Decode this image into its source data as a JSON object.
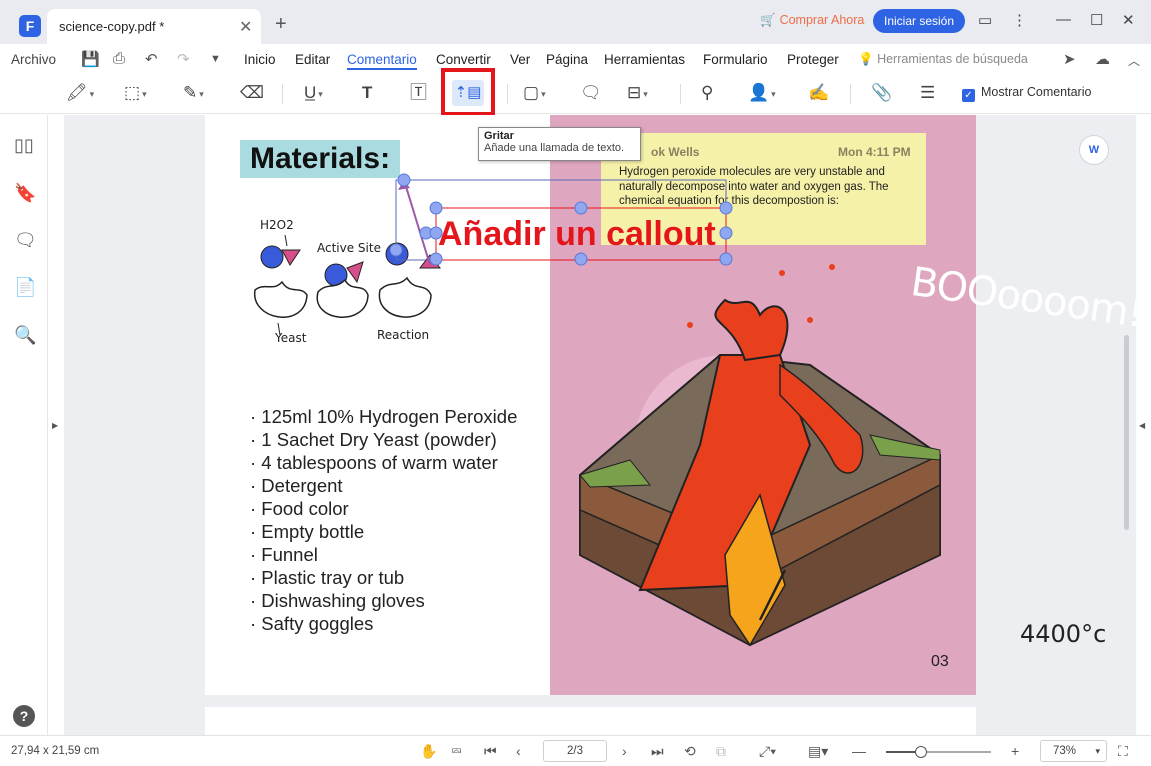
{
  "tab": {
    "title": "science-copy.pdf *",
    "close": "✕",
    "add": "+"
  },
  "titlebar": {
    "buy_label": "Comprar Ahora",
    "login_label": "Iniciar sesión"
  },
  "menu": {
    "items": [
      "Archivo",
      "Inicio",
      "Editar",
      "Comentario",
      "Convertir",
      "Ver",
      "Página",
      "Herramientas",
      "Formulario",
      "Proteger"
    ],
    "active": "Comentario",
    "search_tools": "Herramientas de búsqueda"
  },
  "ribbon": {
    "show_comments_label": "Mostrar Comentario",
    "show_comments_checked": true
  },
  "tooltip": {
    "title": "Gritar",
    "description": "Añade una llamada de texto."
  },
  "document": {
    "heading": "Materials:",
    "materials": [
      "· 125ml 10% Hydrogen Peroxide",
      "· 1 Sachet Dry Yeast (powder)",
      "· 4 tablespoons of warm water",
      "· Detergent",
      "· Food color",
      "· Empty bottle",
      "· Funnel",
      "· Plastic tray or tub",
      "· Dishwashing gloves",
      "· Safty goggles"
    ],
    "diagram_labels": {
      "h2o2": "H2O2",
      "active_site": "Active Site",
      "yeast": "Yeast",
      "reaction": "Reaction"
    },
    "boom_text": "BOOoooom!",
    "temperature": "4400°c",
    "page_number": "03",
    "note": {
      "author": "ok Wells",
      "time": "Mon 4:11 PM",
      "text": "Hydrogen peroxide molecules are very unstable and naturally decompose into water and oxygen gas. The chemical equation for this decompostion is:"
    },
    "callout_text": "Añadir un callout"
  },
  "status": {
    "dimensions": "27,94 x 21,59 cm",
    "page_current": "2",
    "page_total": "/3",
    "zoom": "73%",
    "zoom_fraction": 0.33
  },
  "colors": {
    "accent": "#2e63e3",
    "callout_red": "#e4161c",
    "note_yellow": "#f6f1a8",
    "page_pink": "#dfa6bf"
  }
}
